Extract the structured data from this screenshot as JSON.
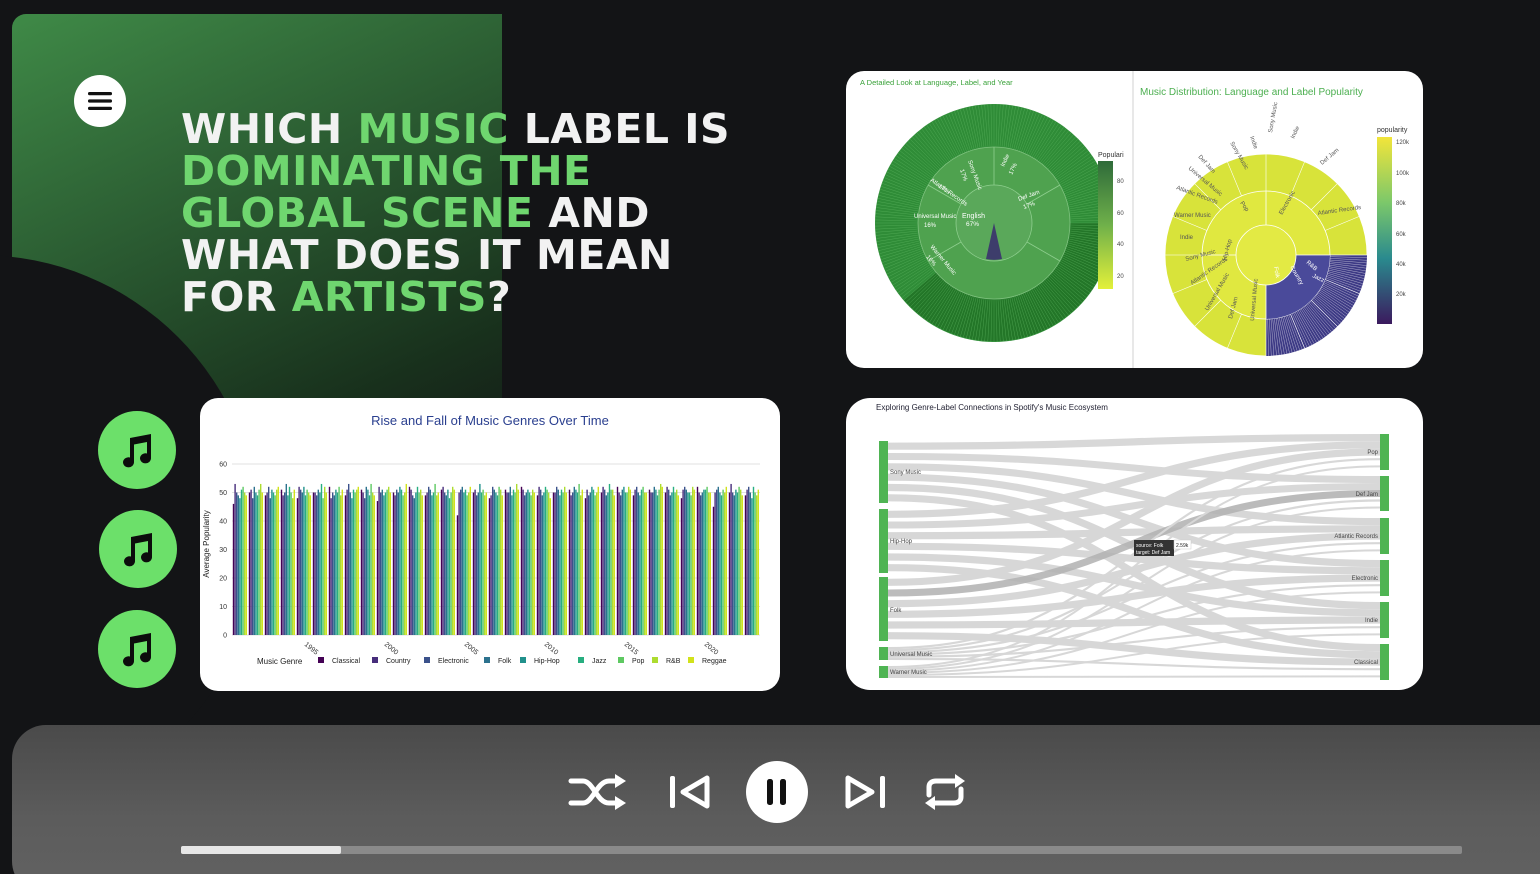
{
  "headline": {
    "line1a": "WHICH ",
    "line1b": "MUSIC",
    "line1c": " LABEL IS",
    "line2": "DOMINATING THE",
    "line3a": "GLOBAL SCENE",
    "line3b": " AND",
    "line4": "WHAT DOES IT MEAN",
    "line5a": "FOR ",
    "line5b": "ARTISTS",
    "line5c": "?"
  },
  "colors": {
    "accent": "#6fd66f",
    "button_green": "#6ce06a",
    "background": "#131416"
  },
  "icons": {
    "menu": "hamburger-menu-icon",
    "note": "music-note-icon",
    "shuffle": "shuffle-icon",
    "prev": "previous-track-icon",
    "pause": "pause-icon",
    "next": "next-track-icon",
    "repeat": "repeat-icon"
  },
  "player": {
    "progress": 0.125
  },
  "charts": {
    "sunburst1": {
      "title": "A Detailed Look at Language, Label, and Year",
      "colorbar_title": "Populari",
      "ticks": [
        "80",
        "60",
        "40",
        "20"
      ]
    },
    "sunburst2": {
      "title": "Music Distribution: Language and Label Popularity",
      "colorbar_title": "popularity",
      "ticks": [
        "120k",
        "100k",
        "80k",
        "60k",
        "40k",
        "20k"
      ]
    },
    "bar": {
      "title": "Rise and Fall of Music Genres Over Time",
      "ylabel": "Average Popularity",
      "legend_title": "Music Genre"
    },
    "sankey": {
      "title": "Exploring Genre-Label Connections in Spotify's Music Ecosystem",
      "tooltip_source": "source: Folk",
      "tooltip_target": "target: Def Jam",
      "tooltip_value": "2.59k"
    }
  },
  "chart_data": [
    {
      "type": "bar",
      "title": "Rise and Fall of Music Genres Over Time",
      "xlabel": "",
      "ylabel": "Average Popularity",
      "ylim": [
        0,
        60
      ],
      "yticks": [
        0,
        10,
        20,
        30,
        40,
        50,
        60
      ],
      "xticks": [
        "1995",
        "2000",
        "2005",
        "2010",
        "2015",
        "2020"
      ],
      "x_range": [
        1991,
        2023
      ],
      "legend_title": "Music Genre",
      "legend_position": "bottom",
      "grid": true,
      "series": [
        {
          "name": "Classical",
          "color": "#440154"
        },
        {
          "name": "Country",
          "color": "#472d7b"
        },
        {
          "name": "Electronic",
          "color": "#3b528b"
        },
        {
          "name": "Folk",
          "color": "#2c728e"
        },
        {
          "name": "Hip-Hop",
          "color": "#21918c"
        },
        {
          "name": "Jazz",
          "color": "#28ae80"
        },
        {
          "name": "Pop",
          "color": "#5ec962"
        },
        {
          "name": "R&B",
          "color": "#addc30"
        },
        {
          "name": "Reggae",
          "color": "#d2e21b"
        }
      ],
      "values_by_year": [
        [
          46,
          53,
          50,
          49,
          48,
          51,
          52,
          50,
          49
        ],
        [
          50,
          51,
          48,
          52,
          50,
          49,
          51,
          53,
          50
        ],
        [
          49,
          50,
          52,
          48,
          51,
          50,
          49,
          51,
          52
        ],
        [
          51,
          49,
          50,
          53,
          49,
          52,
          50,
          48,
          51
        ],
        [
          48,
          52,
          51,
          50,
          52,
          49,
          51,
          50,
          49
        ],
        [
          50,
          50,
          49,
          51,
          50,
          53,
          48,
          52,
          50
        ],
        [
          52,
          48,
          50,
          49,
          51,
          50,
          52,
          49,
          51
        ],
        [
          49,
          51,
          53,
          50,
          48,
          51,
          50,
          51,
          52
        ],
        [
          51,
          50,
          48,
          52,
          51,
          49,
          53,
          50,
          49
        ],
        [
          47,
          52,
          50,
          51,
          49,
          50,
          51,
          52,
          50
        ],
        [
          50,
          49,
          51,
          50,
          52,
          51,
          49,
          50,
          53
        ],
        [
          52,
          51,
          49,
          48,
          50,
          52,
          50,
          51,
          49
        ],
        [
          49,
          50,
          52,
          51,
          49,
          50,
          53,
          49,
          50
        ],
        [
          51,
          52,
          50,
          49,
          51,
          48,
          50,
          52,
          51
        ],
        [
          42,
          50,
          51,
          52,
          50,
          51,
          49,
          50,
          52
        ],
        [
          50,
          51,
          49,
          50,
          53,
          50,
          51,
          49,
          50
        ],
        [
          48,
          49,
          52,
          51,
          50,
          49,
          52,
          51,
          49
        ],
        [
          51,
          50,
          50,
          52,
          49,
          51,
          50,
          53,
          51
        ],
        [
          52,
          51,
          49,
          50,
          51,
          50,
          49,
          51,
          50
        ],
        [
          49,
          52,
          51,
          49,
          50,
          52,
          51,
          50,
          48
        ],
        [
          50,
          50,
          52,
          51,
          49,
          51,
          50,
          52,
          50
        ],
        [
          51,
          49,
          50,
          52,
          51,
          50,
          53,
          49,
          51
        ],
        [
          48,
          51,
          49,
          50,
          52,
          51,
          49,
          50,
          52
        ],
        [
          50,
          52,
          51,
          49,
          50,
          53,
          51,
          51,
          49
        ],
        [
          52,
          50,
          49,
          51,
          52,
          50,
          50,
          52,
          51
        ],
        [
          49,
          51,
          52,
          50,
          49,
          51,
          52,
          50,
          50
        ],
        [
          51,
          50,
          50,
          52,
          51,
          49,
          51,
          53,
          52
        ],
        [
          50,
          52,
          51,
          49,
          50,
          52,
          50,
          51,
          49
        ],
        [
          48,
          51,
          52,
          51,
          50,
          50,
          49,
          52,
          51
        ],
        [
          52,
          50,
          49,
          50,
          51,
          51,
          52,
          50,
          50
        ],
        [
          45,
          50,
          51,
          52,
          50,
          49,
          51,
          50,
          52
        ],
        [
          50,
          53,
          50,
          49,
          51,
          50,
          52,
          51,
          49
        ],
        [
          49,
          51,
          52,
          50,
          48,
          52,
          50,
          49,
          51
        ]
      ]
    },
    {
      "type": "sunburst",
      "title": "A Detailed Look at Language, Label, and Year",
      "colorbar_title": "Populari",
      "colorbar_ticks": [
        20,
        40,
        60,
        80
      ],
      "center_labels": [
        "English",
        "67%"
      ],
      "label_segments": [
        {
          "label": "Sony Music",
          "pct": "17%"
        },
        {
          "label": "Indie",
          "pct": "17%"
        },
        {
          "label": "Def Jam",
          "pct": "17%"
        },
        {
          "label": "Warner Music",
          "pct": "16%"
        },
        {
          "label": "Universal Music",
          "pct": "16%"
        },
        {
          "label": "Atlantic Records",
          "pct": "17%"
        }
      ]
    },
    {
      "type": "sunburst",
      "title": "Music Distribution: Language and Label Popularity",
      "colorbar_title": "popularity",
      "colorbar_ticks": [
        "20k",
        "40k",
        "60k",
        "80k",
        "100k",
        "120k"
      ],
      "inner_labels": [
        "Pop",
        "Electronic",
        "Hip-Hop",
        "Folk",
        "Country",
        "R&B",
        "Jazz"
      ],
      "outer_labels": [
        "Indie",
        "Sony Music",
        "Universal Music",
        "Def Jam",
        "Atlantic Records",
        "Warner Music",
        "Indie",
        "Sony Music",
        "Atlantic Records",
        "Universal Music",
        "Def Jam",
        "Universal Music",
        "Sony Music",
        "Indie",
        "Def Jam",
        "Atlantic Records"
      ]
    },
    {
      "type": "sankey",
      "title": "Exploring Genre-Label Connections in Spotify's Music Ecosystem",
      "sources": [
        "Sony Music",
        "Hip-Hop",
        "Folk",
        "Universal Music",
        "Warner Music"
      ],
      "targets": [
        "Pop",
        "Def Jam",
        "Atlantic Records",
        "Electronic",
        "Indie",
        "Classical"
      ],
      "tooltip": {
        "source": "Folk",
        "target": "Def Jam",
        "value": "2.59k"
      }
    }
  ]
}
